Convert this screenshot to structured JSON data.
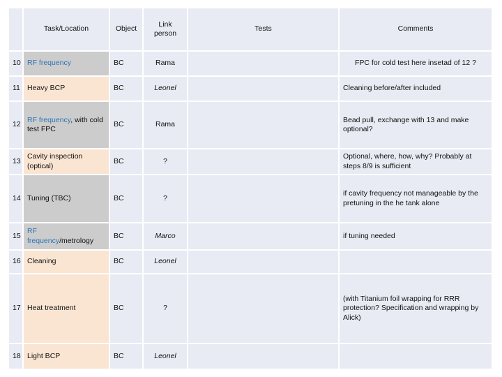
{
  "table": {
    "headers": {
      "rownum": "",
      "task": "Task/Location",
      "object": "Object",
      "link_person": "Link person",
      "tests": "Tests",
      "comments": "Comments"
    },
    "rows": [
      {
        "num": "10",
        "task_blue": "RF frequency",
        "task_black": "",
        "task_fill": "gray",
        "object": "BC",
        "link_person": "Rama",
        "link_italic": false,
        "tests": "",
        "comments": "FPC for cold test here insetad of 12 ?",
        "comments_indent": true
      },
      {
        "num": "11",
        "task_blue": "",
        "task_black": "Heavy BCP",
        "task_fill": "peach",
        "object": "BC",
        "link_person": "Leonel",
        "link_italic": true,
        "tests": "",
        "comments": "Cleaning before/after included",
        "comments_indent": false
      },
      {
        "num": "12",
        "task_blue": "RF frequency",
        "task_black": ",  with cold test FPC",
        "task_fill": "gray",
        "object": "BC",
        "link_person": "Rama",
        "link_italic": false,
        "tests": "",
        "comments": "Bead pull, exchange with 13 and make optional?",
        "comments_indent": false
      },
      {
        "num": "13",
        "task_blue": "",
        "task_black": "Cavity inspection (optical)",
        "task_fill": "peach",
        "object": "BC",
        "link_person": "?",
        "link_italic": false,
        "tests": "",
        "comments": "Optional, where, how, why? Probably at steps 8/9 is sufficient",
        "comments_indent": false
      },
      {
        "num": "14",
        "task_blue": "",
        "task_black": "Tuning (TBC)",
        "task_fill": "gray",
        "object": "BC",
        "link_person": "?",
        "link_italic": false,
        "tests": "",
        "comments": "if cavity frequency not manageable by the pretuning in the he tank alone",
        "comments_indent": false
      },
      {
        "num": "15",
        "task_blue": "RF frequency",
        "task_black": "/metrology",
        "task_fill": "gray",
        "object": "BC",
        "link_person": "Marco",
        "link_italic": true,
        "tests": "",
        "comments": "if tuning needed",
        "comments_indent": false
      },
      {
        "num": "16",
        "task_blue": "",
        "task_black": "Cleaning",
        "task_fill": "peach",
        "object": "BC",
        "link_person": "Leonel",
        "link_italic": true,
        "tests": "",
        "comments": "",
        "comments_indent": false
      },
      {
        "num": "17",
        "task_blue": "",
        "task_black": "Heat treatment",
        "task_fill": "peach",
        "object": "BC",
        "link_person": "?",
        "link_italic": false,
        "tests": "",
        "comments": "(with Titanium foil wrapping for RRR protection? Specification and wrapping by Alick)",
        "comments_indent": false
      },
      {
        "num": "18",
        "task_blue": "",
        "task_black": "Light BCP",
        "task_fill": "peach",
        "object": "BC",
        "link_person": "Leonel",
        "link_italic": true,
        "tests": "",
        "comments": "",
        "comments_indent": false
      }
    ]
  },
  "colors": {
    "cell_background": "#E8EBF3",
    "fill_gray": "#CCCCCC",
    "fill_peach": "#FAE5D3",
    "link_text_blue": "#2E74B5",
    "gridline": "#FFFFFF"
  }
}
